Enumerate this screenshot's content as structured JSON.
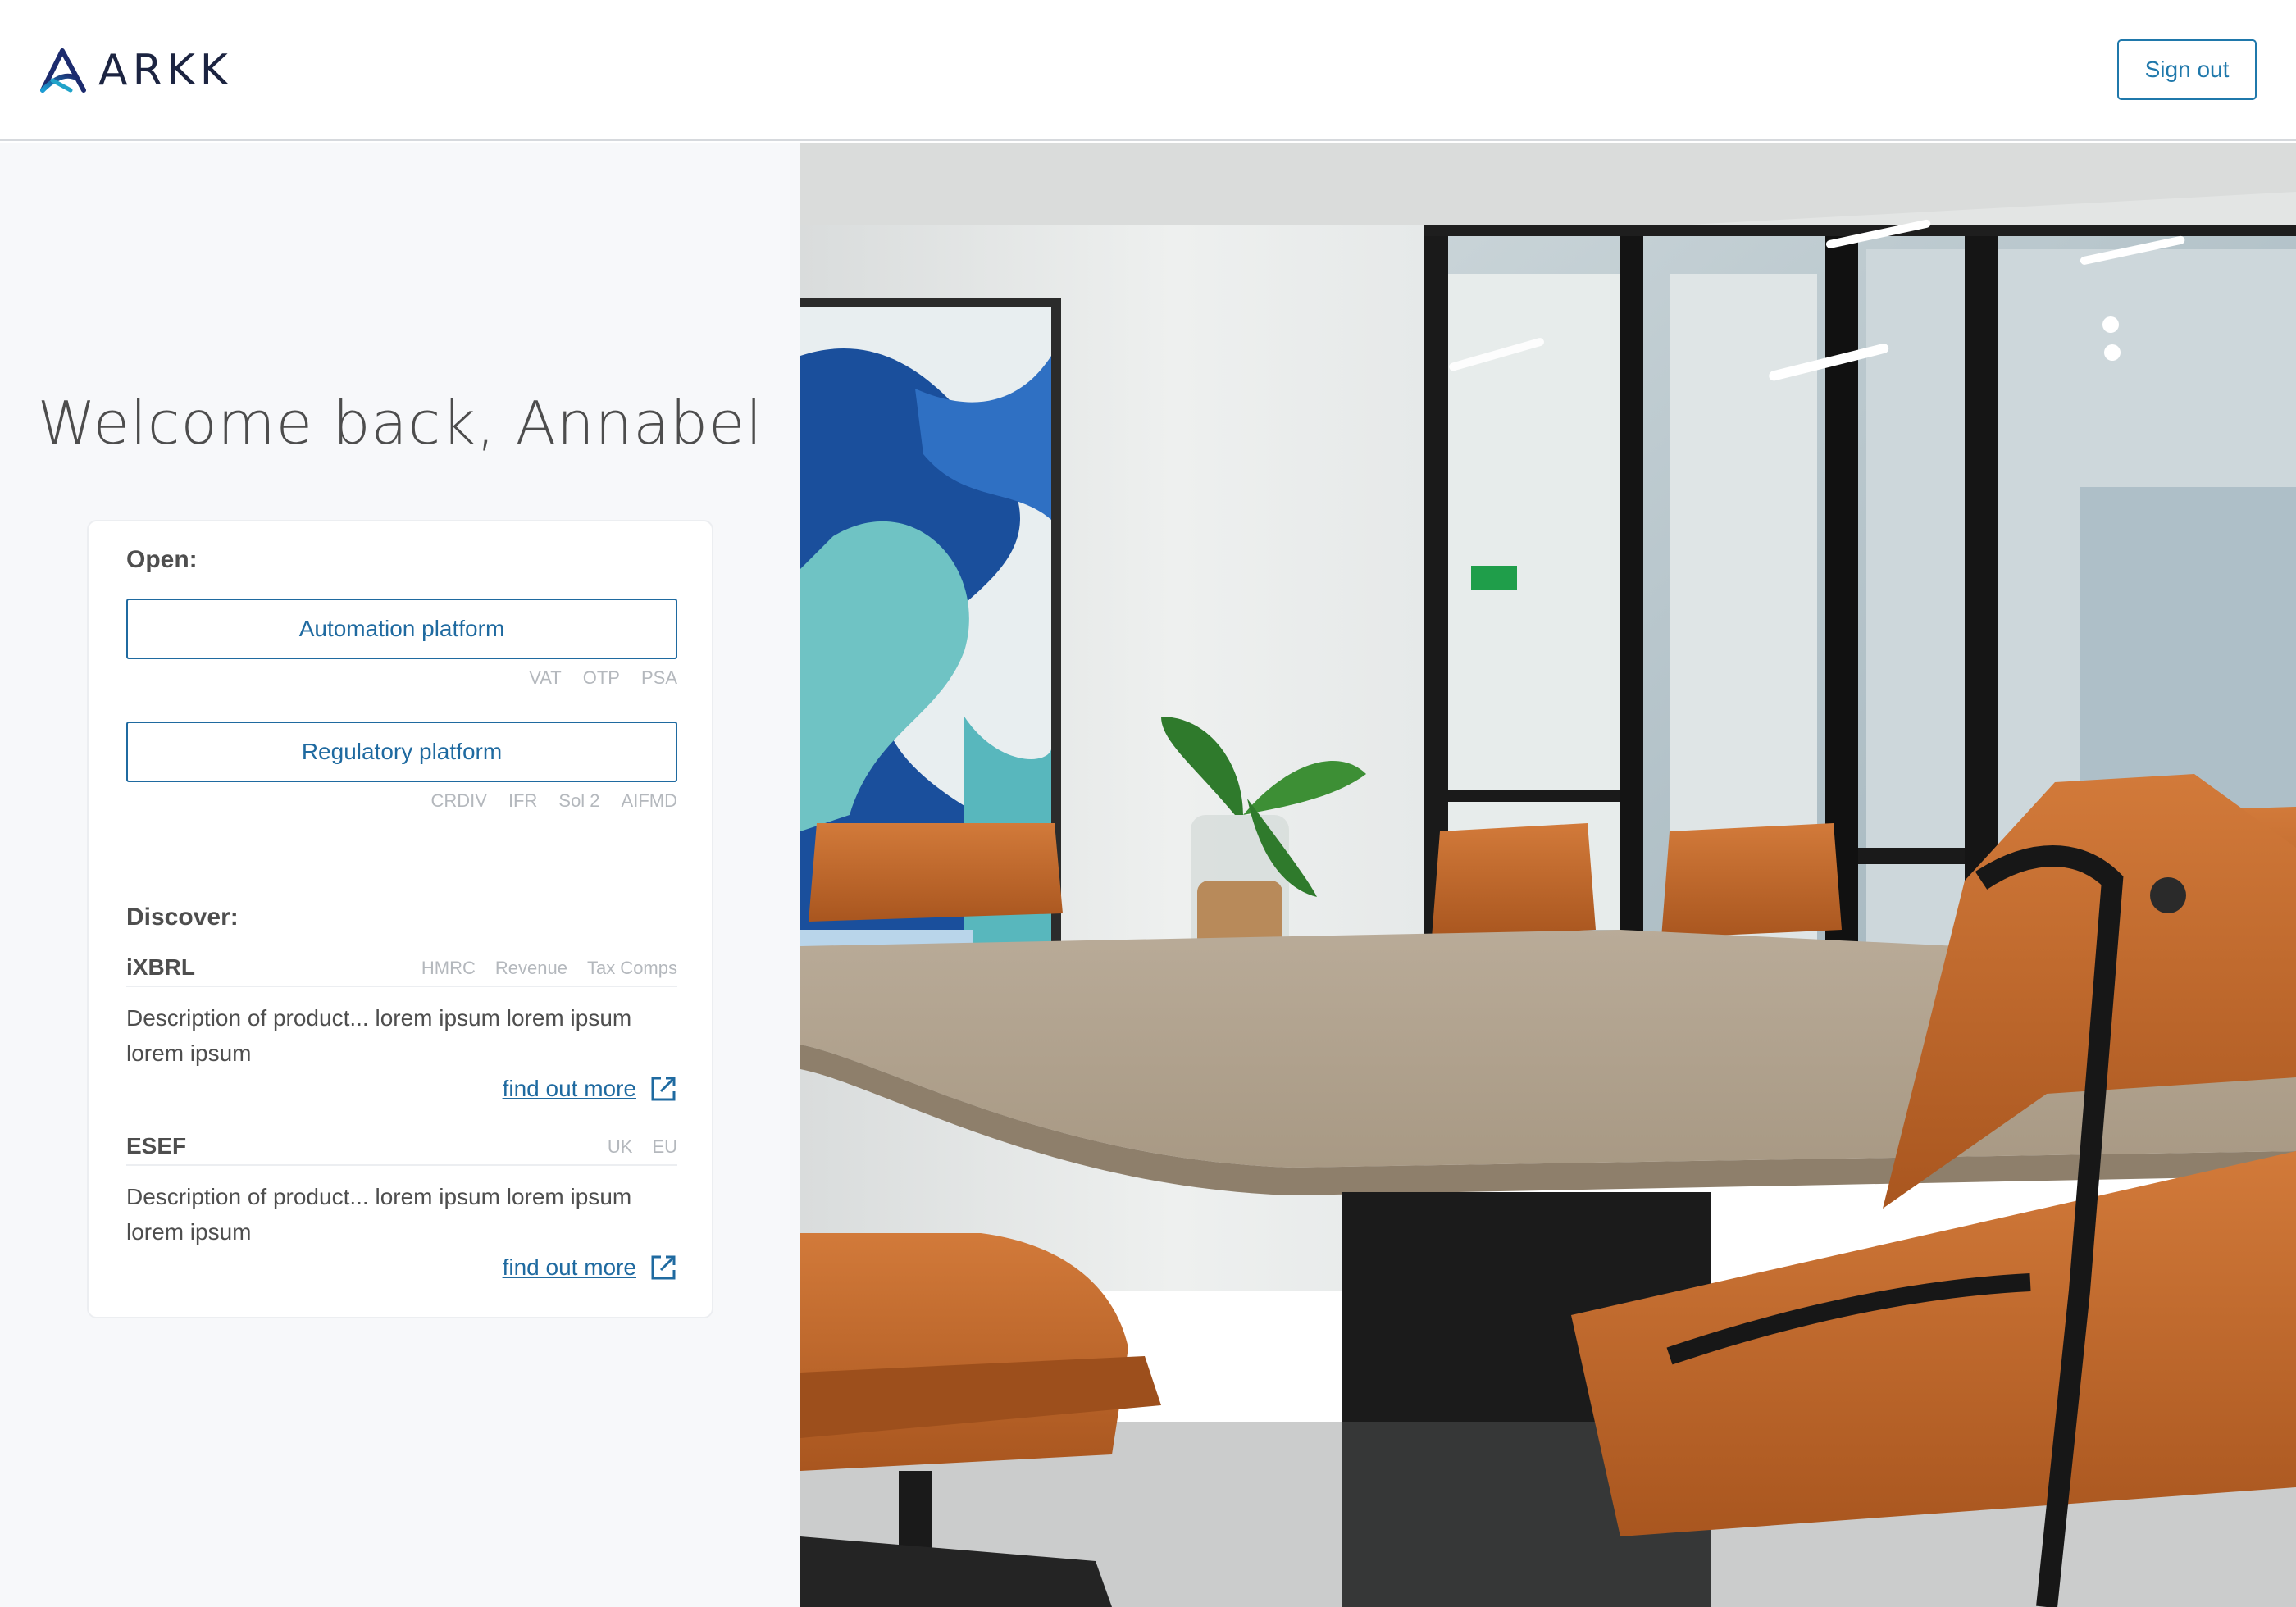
{
  "header": {
    "logo_text": "ARKK",
    "signout_label": "Sign out"
  },
  "welcome": "Welcome back, Annabel",
  "open": {
    "title": "Open:",
    "platforms": [
      {
        "label": "Automation platform",
        "tags": [
          "VAT",
          "OTP",
          "PSA"
        ]
      },
      {
        "label": "Regulatory platform",
        "tags": [
          "CRDIV",
          "IFR",
          "Sol 2",
          "AIFMD"
        ]
      }
    ]
  },
  "discover": {
    "title": "Discover:",
    "products": [
      {
        "name": "iXBRL",
        "tags": [
          "HMRC",
          "Revenue",
          "Tax Comps"
        ],
        "description": "Description of product... lorem ipsum lorem ipsum lorem ipsum",
        "link": "find out more"
      },
      {
        "name": "ESEF",
        "tags": [
          "UK",
          "EU"
        ],
        "description": "Description of product... lorem ipsum lorem ipsum lorem ipsum",
        "link": "find out more"
      }
    ]
  },
  "colors": {
    "brand_navy": "#1c2441",
    "accent_blue": "#1f78ab",
    "panel_bg": "#f7f8fa",
    "chair_orange": "#c46a2f"
  },
  "icons": {
    "logo": "arkk-triangle-logo",
    "external_link": "external-link-icon"
  }
}
